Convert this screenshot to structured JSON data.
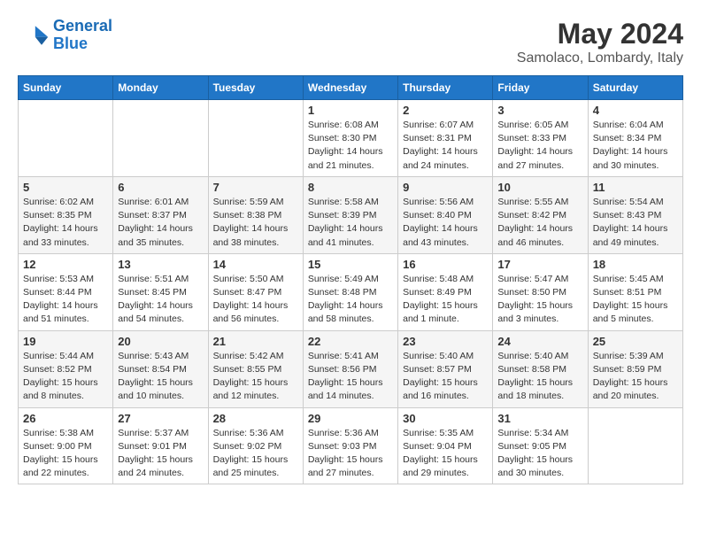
{
  "header": {
    "logo_line1": "General",
    "logo_line2": "Blue",
    "month": "May 2024",
    "location": "Samolaco, Lombardy, Italy"
  },
  "weekdays": [
    "Sunday",
    "Monday",
    "Tuesday",
    "Wednesday",
    "Thursday",
    "Friday",
    "Saturday"
  ],
  "weeks": [
    [
      {
        "day": "",
        "info": ""
      },
      {
        "day": "",
        "info": ""
      },
      {
        "day": "",
        "info": ""
      },
      {
        "day": "1",
        "info": "Sunrise: 6:08 AM\nSunset: 8:30 PM\nDaylight: 14 hours\nand 21 minutes."
      },
      {
        "day": "2",
        "info": "Sunrise: 6:07 AM\nSunset: 8:31 PM\nDaylight: 14 hours\nand 24 minutes."
      },
      {
        "day": "3",
        "info": "Sunrise: 6:05 AM\nSunset: 8:33 PM\nDaylight: 14 hours\nand 27 minutes."
      },
      {
        "day": "4",
        "info": "Sunrise: 6:04 AM\nSunset: 8:34 PM\nDaylight: 14 hours\nand 30 minutes."
      }
    ],
    [
      {
        "day": "5",
        "info": "Sunrise: 6:02 AM\nSunset: 8:35 PM\nDaylight: 14 hours\nand 33 minutes."
      },
      {
        "day": "6",
        "info": "Sunrise: 6:01 AM\nSunset: 8:37 PM\nDaylight: 14 hours\nand 35 minutes."
      },
      {
        "day": "7",
        "info": "Sunrise: 5:59 AM\nSunset: 8:38 PM\nDaylight: 14 hours\nand 38 minutes."
      },
      {
        "day": "8",
        "info": "Sunrise: 5:58 AM\nSunset: 8:39 PM\nDaylight: 14 hours\nand 41 minutes."
      },
      {
        "day": "9",
        "info": "Sunrise: 5:56 AM\nSunset: 8:40 PM\nDaylight: 14 hours\nand 43 minutes."
      },
      {
        "day": "10",
        "info": "Sunrise: 5:55 AM\nSunset: 8:42 PM\nDaylight: 14 hours\nand 46 minutes."
      },
      {
        "day": "11",
        "info": "Sunrise: 5:54 AM\nSunset: 8:43 PM\nDaylight: 14 hours\nand 49 minutes."
      }
    ],
    [
      {
        "day": "12",
        "info": "Sunrise: 5:53 AM\nSunset: 8:44 PM\nDaylight: 14 hours\nand 51 minutes."
      },
      {
        "day": "13",
        "info": "Sunrise: 5:51 AM\nSunset: 8:45 PM\nDaylight: 14 hours\nand 54 minutes."
      },
      {
        "day": "14",
        "info": "Sunrise: 5:50 AM\nSunset: 8:47 PM\nDaylight: 14 hours\nand 56 minutes."
      },
      {
        "day": "15",
        "info": "Sunrise: 5:49 AM\nSunset: 8:48 PM\nDaylight: 14 hours\nand 58 minutes."
      },
      {
        "day": "16",
        "info": "Sunrise: 5:48 AM\nSunset: 8:49 PM\nDaylight: 15 hours\nand 1 minute."
      },
      {
        "day": "17",
        "info": "Sunrise: 5:47 AM\nSunset: 8:50 PM\nDaylight: 15 hours\nand 3 minutes."
      },
      {
        "day": "18",
        "info": "Sunrise: 5:45 AM\nSunset: 8:51 PM\nDaylight: 15 hours\nand 5 minutes."
      }
    ],
    [
      {
        "day": "19",
        "info": "Sunrise: 5:44 AM\nSunset: 8:52 PM\nDaylight: 15 hours\nand 8 minutes."
      },
      {
        "day": "20",
        "info": "Sunrise: 5:43 AM\nSunset: 8:54 PM\nDaylight: 15 hours\nand 10 minutes."
      },
      {
        "day": "21",
        "info": "Sunrise: 5:42 AM\nSunset: 8:55 PM\nDaylight: 15 hours\nand 12 minutes."
      },
      {
        "day": "22",
        "info": "Sunrise: 5:41 AM\nSunset: 8:56 PM\nDaylight: 15 hours\nand 14 minutes."
      },
      {
        "day": "23",
        "info": "Sunrise: 5:40 AM\nSunset: 8:57 PM\nDaylight: 15 hours\nand 16 minutes."
      },
      {
        "day": "24",
        "info": "Sunrise: 5:40 AM\nSunset: 8:58 PM\nDaylight: 15 hours\nand 18 minutes."
      },
      {
        "day": "25",
        "info": "Sunrise: 5:39 AM\nSunset: 8:59 PM\nDaylight: 15 hours\nand 20 minutes."
      }
    ],
    [
      {
        "day": "26",
        "info": "Sunrise: 5:38 AM\nSunset: 9:00 PM\nDaylight: 15 hours\nand 22 minutes."
      },
      {
        "day": "27",
        "info": "Sunrise: 5:37 AM\nSunset: 9:01 PM\nDaylight: 15 hours\nand 24 minutes."
      },
      {
        "day": "28",
        "info": "Sunrise: 5:36 AM\nSunset: 9:02 PM\nDaylight: 15 hours\nand 25 minutes."
      },
      {
        "day": "29",
        "info": "Sunrise: 5:36 AM\nSunset: 9:03 PM\nDaylight: 15 hours\nand 27 minutes."
      },
      {
        "day": "30",
        "info": "Sunrise: 5:35 AM\nSunset: 9:04 PM\nDaylight: 15 hours\nand 29 minutes."
      },
      {
        "day": "31",
        "info": "Sunrise: 5:34 AM\nSunset: 9:05 PM\nDaylight: 15 hours\nand 30 minutes."
      },
      {
        "day": "",
        "info": ""
      }
    ]
  ]
}
